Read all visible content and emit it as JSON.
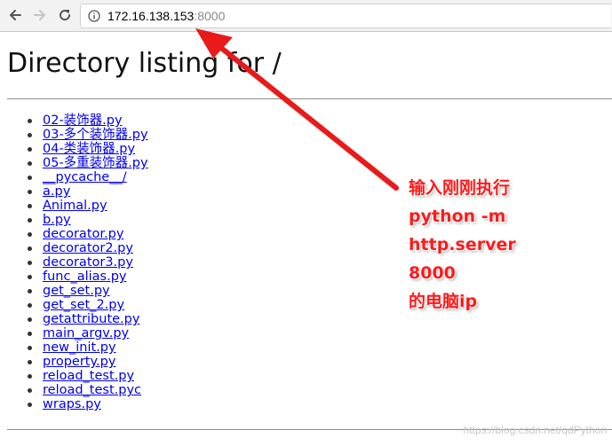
{
  "browser": {
    "url_host": "172.16.138.153",
    "url_port": ":8000",
    "icons": {
      "back": "arrow-left-icon",
      "forward": "arrow-right-icon",
      "reload": "reload-icon",
      "info": "info-icon"
    }
  },
  "page": {
    "title": "Directory listing for /",
    "files": [
      "02-装饰器.py",
      "03-多个装饰器.py",
      "04-类装饰器.py",
      "05-多重装饰器.py",
      "__pycache__/",
      "a.py",
      "Animal.py",
      "b.py",
      "decorator.py",
      "decorator2.py",
      "decorator3.py",
      "func_alias.py",
      "get_set.py",
      "get_set_2.py",
      "getattribute.py",
      "main_argv.py",
      "new_init.py",
      "property.py",
      "reload_test.py",
      "reload_test.pyc",
      "wraps.py"
    ]
  },
  "annotation": {
    "lines": [
      "输入刚刚执行",
      "python -m",
      "http.server",
      "8000",
      "的电脑ip"
    ],
    "color": "#ff1a1a"
  },
  "watermark": "https://blog.csdn.net/qdPython",
  "colors": {
    "link": "#0000ee",
    "toolbar": "#f2f2f2"
  }
}
